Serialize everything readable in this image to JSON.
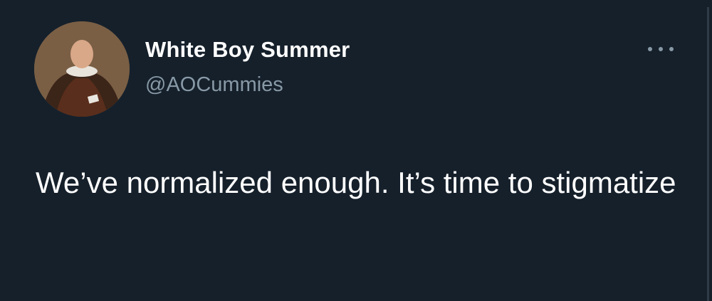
{
  "tweet": {
    "author": {
      "display_name": "White Boy Summer",
      "handle": "@AOCummies"
    },
    "text": "We’ve normalized enough. It’s time to stigmatize"
  },
  "icons": {
    "avatar": "profile-avatar",
    "more": "more-options-icon"
  },
  "colors": {
    "background": "#15202b",
    "primary_text": "#ffffff",
    "secondary_text": "#8899a6"
  }
}
